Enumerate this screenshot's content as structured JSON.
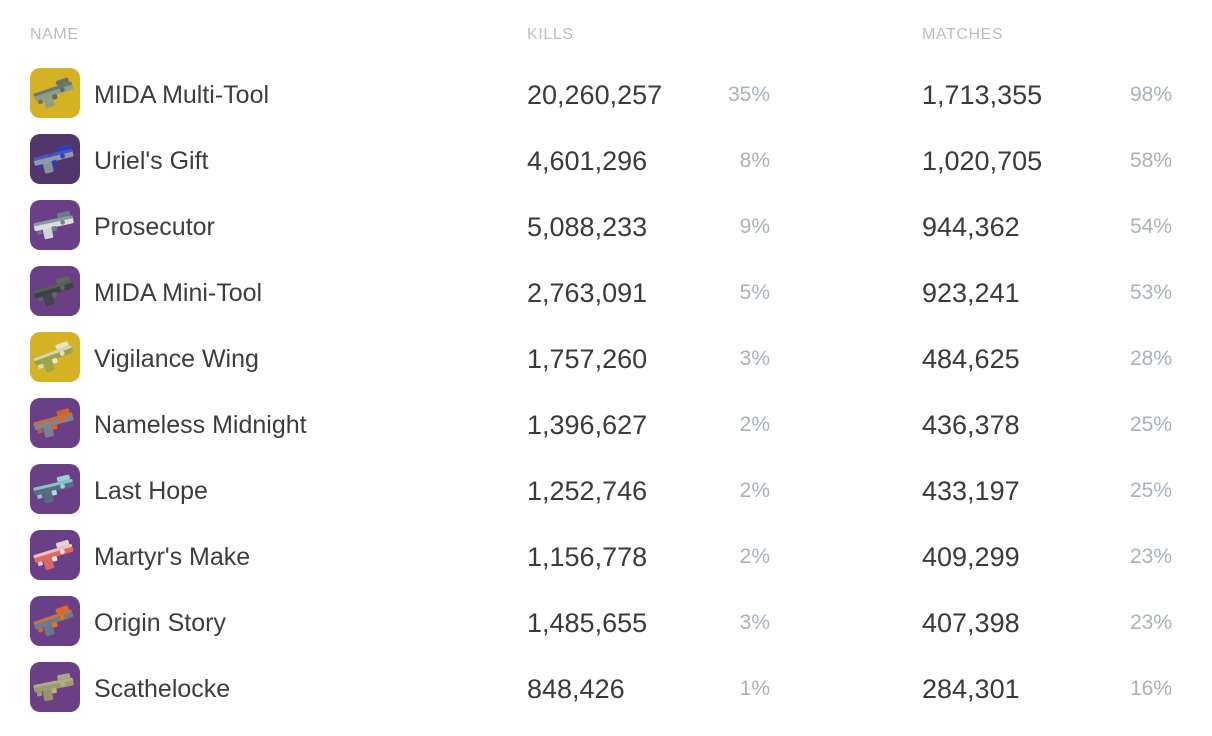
{
  "table": {
    "columns": {
      "name": "NAME",
      "kills": "KILLS",
      "matches": "MATCHES"
    },
    "rows": [
      {
        "name": "MIDA Multi-Tool",
        "kills": "20,260,257",
        "kills_pct": "35%",
        "matches": "1,713,355",
        "matches_pct": "98%",
        "icon": "weapon-icon-mida-multi-tool",
        "rarity_color": "#d4b223",
        "weapon_body": "#8e9a8a",
        "weapon_accent": "#5d6b62"
      },
      {
        "name": "Uriel's Gift",
        "kills": "4,601,296",
        "kills_pct": "8%",
        "matches": "1,020,705",
        "matches_pct": "58%",
        "icon": "weapon-icon-uriels-gift",
        "rarity_color": "#52356b",
        "weapon_body": "#8e9aa6",
        "weapon_accent": "#2b3ec9"
      },
      {
        "name": "Prosecutor",
        "kills": "5,088,233",
        "kills_pct": "9%",
        "matches": "944,362",
        "matches_pct": "54%",
        "icon": "weapon-icon-prosecutor",
        "rarity_color": "#6b3f86",
        "weapon_body": "#d8dde0",
        "weapon_accent": "#6d7f8c"
      },
      {
        "name": "MIDA Mini-Tool",
        "kills": "2,763,091",
        "kills_pct": "5%",
        "matches": "923,241",
        "matches_pct": "53%",
        "icon": "weapon-icon-mida-mini-tool",
        "rarity_color": "#6b3f86",
        "weapon_body": "#3e4248",
        "weapon_accent": "#5f6a58"
      },
      {
        "name": "Vigilance Wing",
        "kills": "1,757,260",
        "kills_pct": "3%",
        "matches": "484,625",
        "matches_pct": "28%",
        "icon": "weapon-icon-vigilance-wing",
        "rarity_color": "#d4b223",
        "weapon_body": "#9aa54b",
        "weapon_accent": "#e8e4d6"
      },
      {
        "name": "Nameless Midnight",
        "kills": "1,396,627",
        "kills_pct": "2%",
        "matches": "436,378",
        "matches_pct": "25%",
        "icon": "weapon-icon-nameless-midnight",
        "rarity_color": "#6b3f86",
        "weapon_body": "#7b8894",
        "weapon_accent": "#e0651f"
      },
      {
        "name": "Last Hope",
        "kills": "1,252,746",
        "kills_pct": "2%",
        "matches": "433,197",
        "matches_pct": "25%",
        "icon": "weapon-icon-last-hope",
        "rarity_color": "#6b3f86",
        "weapon_body": "#5a6b7d",
        "weapon_accent": "#9be0e0"
      },
      {
        "name": "Martyr's Make",
        "kills": "1,156,778",
        "kills_pct": "2%",
        "matches": "409,299",
        "matches_pct": "23%",
        "icon": "weapon-icon-martyrs-make",
        "rarity_color": "#6b3f86",
        "weapon_body": "#e06a63",
        "weapon_accent": "#f0e3e0"
      },
      {
        "name": "Origin Story",
        "kills": "1,485,655",
        "kills_pct": "3%",
        "matches": "407,398",
        "matches_pct": "23%",
        "icon": "weapon-icon-origin-story",
        "rarity_color": "#6b3f86",
        "weapon_body": "#6d7b8c",
        "weapon_accent": "#e8701a"
      },
      {
        "name": "Scathelocke",
        "kills": "848,426",
        "kills_pct": "1%",
        "matches": "284,301",
        "matches_pct": "16%",
        "icon": "weapon-icon-scathelocke",
        "rarity_color": "#6b3f86",
        "weapon_body": "#9a9a72",
        "weapon_accent": "#b5b08a"
      }
    ]
  },
  "colors": {
    "background": "#ffffff",
    "header_text": "#b6bfc4",
    "primary_text": "#3a3a3a",
    "muted_text": "#a9b2b7",
    "exotic": "#d4b223",
    "legendary": "#6b3f86"
  }
}
